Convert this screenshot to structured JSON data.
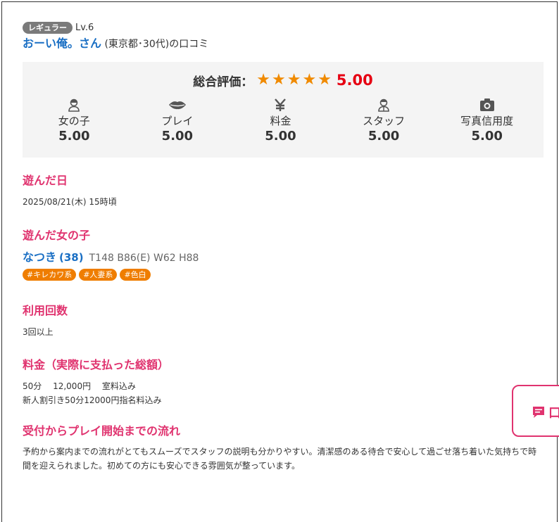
{
  "reviewer": {
    "rank_badge": "レギュラー",
    "level": "Lv.6",
    "name": "おーい俺。さん",
    "meta": "(東京都･30代)の口コミ"
  },
  "rating": {
    "total_label": "総合評価：",
    "total_score": "5.00",
    "stars": 5,
    "star_color": "#f08a00",
    "score_color": "#e60012",
    "categories": [
      {
        "icon": "girl-icon",
        "label": "女の子",
        "score": "5.00"
      },
      {
        "icon": "lips-icon",
        "label": "プレイ",
        "score": "5.00"
      },
      {
        "icon": "yen-icon",
        "label": "料金",
        "score": "5.00"
      },
      {
        "icon": "staff-icon",
        "label": "スタッフ",
        "score": "5.00"
      },
      {
        "icon": "camera-icon",
        "label": "写真信用度",
        "score": "5.00"
      }
    ]
  },
  "visit_date": {
    "title": "遊んだ日",
    "value": "2025/08/21(木) 15時頃"
  },
  "girl": {
    "title": "遊んだ女の子",
    "name": "なつき",
    "age": "(38)",
    "spec": "T148 B86(E) W62 H88",
    "tags": [
      "#キレカワ系",
      "#人妻系",
      "#色白"
    ]
  },
  "usage_count": {
    "title": "利用回数",
    "value": "3回以上"
  },
  "price": {
    "title": "料金（実際に支払った総額）",
    "line1": "50分　 12,000円　 室料込み",
    "line2": "新人割引き50分12000円指名料込み"
  },
  "flow": {
    "title": "受付からプレイ開始までの流れ",
    "text": "予約から案内までの流れがとてもスムーズでスタッフの説明も分かりやすい。清潔感のある待合で安心して過ごせ落ち着いた気持ちで時間を迎えられました。初めての方にも安心できる雰囲気が整っています。"
  },
  "floating_tab": {
    "label": "口"
  },
  "colors": {
    "accent_pink": "#e0336f",
    "link_blue": "#1a6fc4",
    "tag_orange": "#ef7d00"
  }
}
